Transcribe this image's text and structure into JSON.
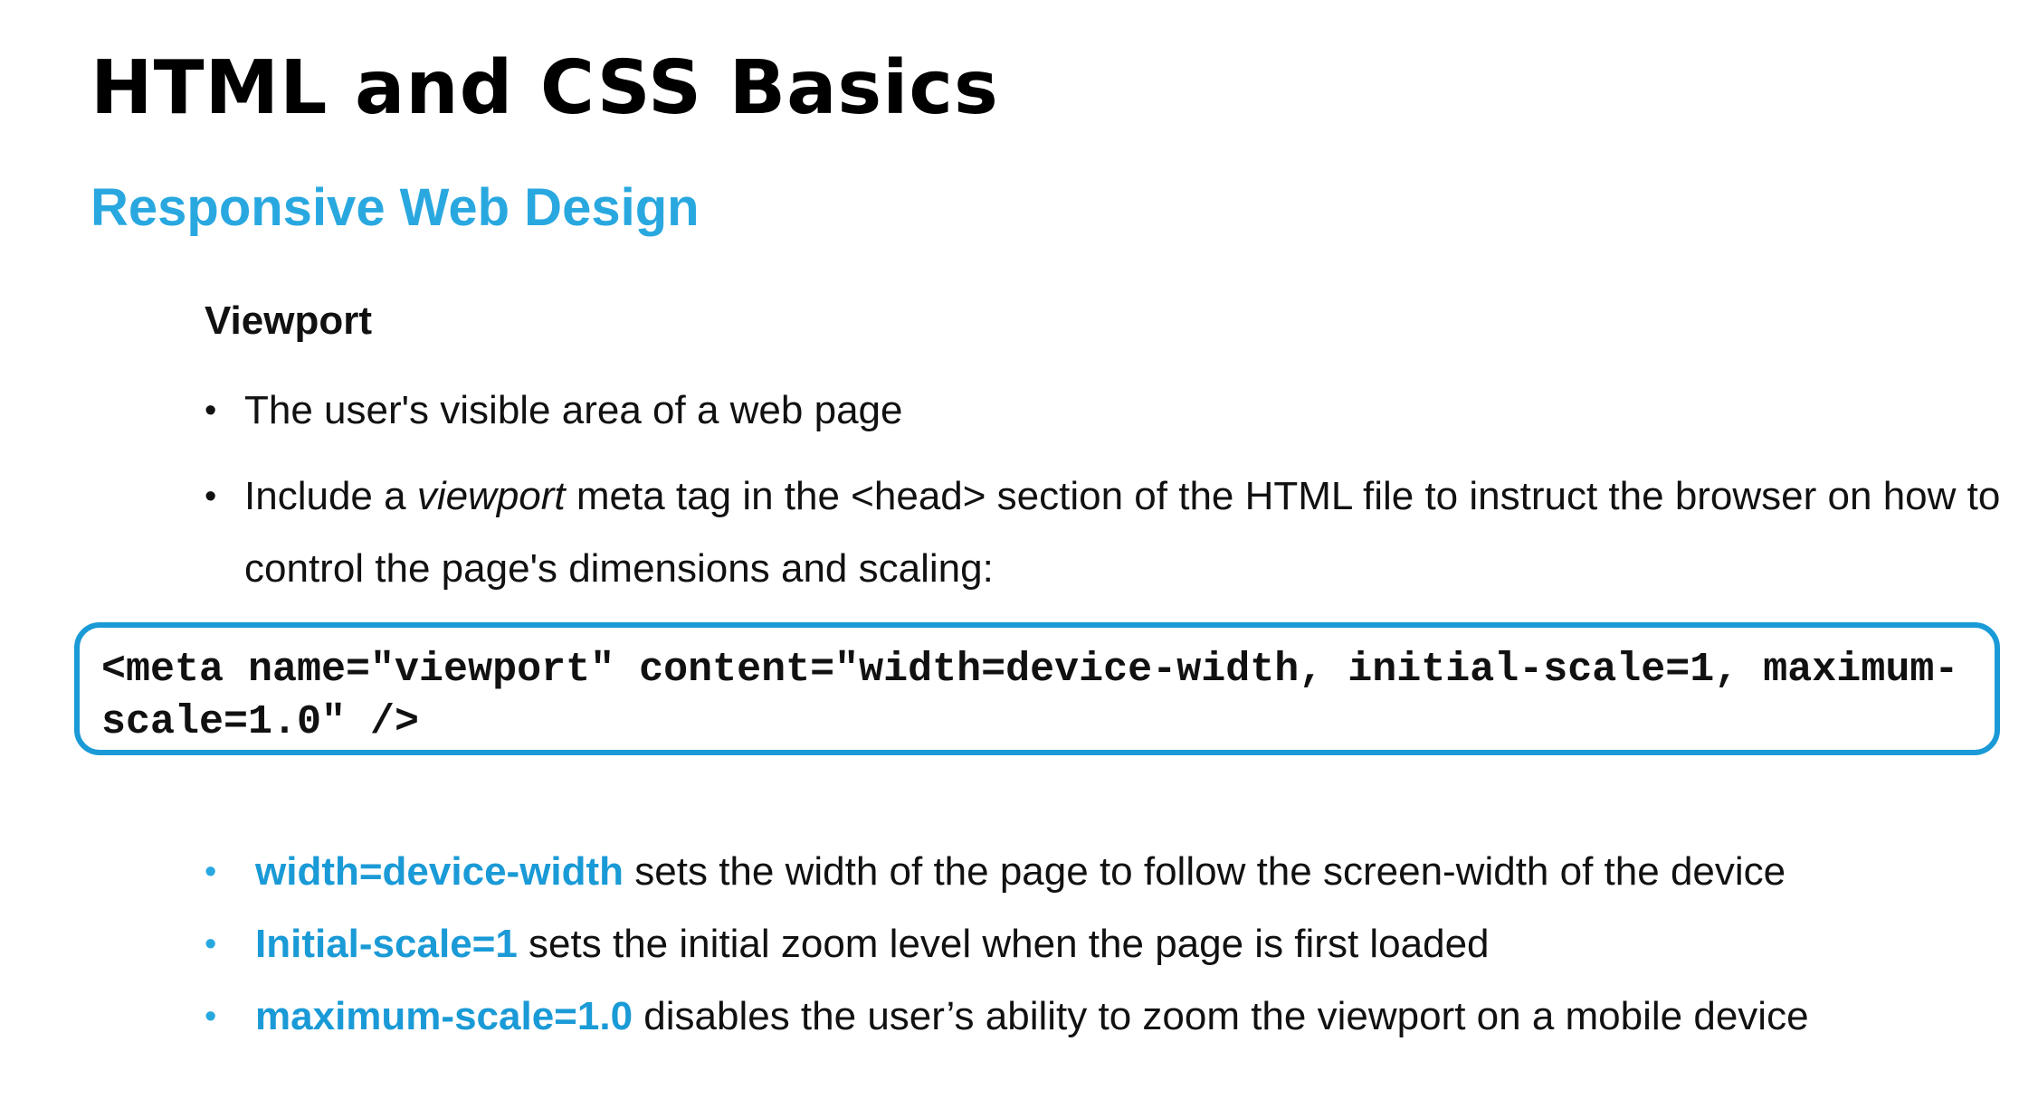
{
  "slide": {
    "title": "HTML and CSS Basics",
    "subtitle": "Responsive Web Design",
    "section_heading": "Viewport",
    "intro_bullets": [
      {
        "bullet": "•",
        "text_before": "The user's visible area of a web page",
        "emphasis": "",
        "text_after": ""
      },
      {
        "bullet": "•",
        "text_before": "Include a ",
        "emphasis": "viewport",
        "text_after": " meta tag in the <head> section of the HTML file to instruct the browser on how to control the page's dimensions and scaling:"
      }
    ],
    "code_snippet": "<meta name=\"viewport\" content=\"width=device-width, initial-scale=1, maximum-scale=1.0\" />",
    "param_bullets": [
      {
        "bullet": "•",
        "key": "width=device-width",
        "description": " sets the width of the page to follow the screen-width of the device"
      },
      {
        "bullet": "•",
        "key": "Initial-scale=1",
        "description": " sets the initial zoom level when the page is first loaded"
      },
      {
        "bullet": "•",
        "key": "maximum-scale=1.0",
        "description": " disables the user’s ability to zoom the viewport on a mobile device"
      }
    ]
  },
  "colors": {
    "accent": "#29a8e0",
    "code_border": "#1a9ad6",
    "title_text": "#000000",
    "body_text": "#111111",
    "background": "#ffffff"
  }
}
